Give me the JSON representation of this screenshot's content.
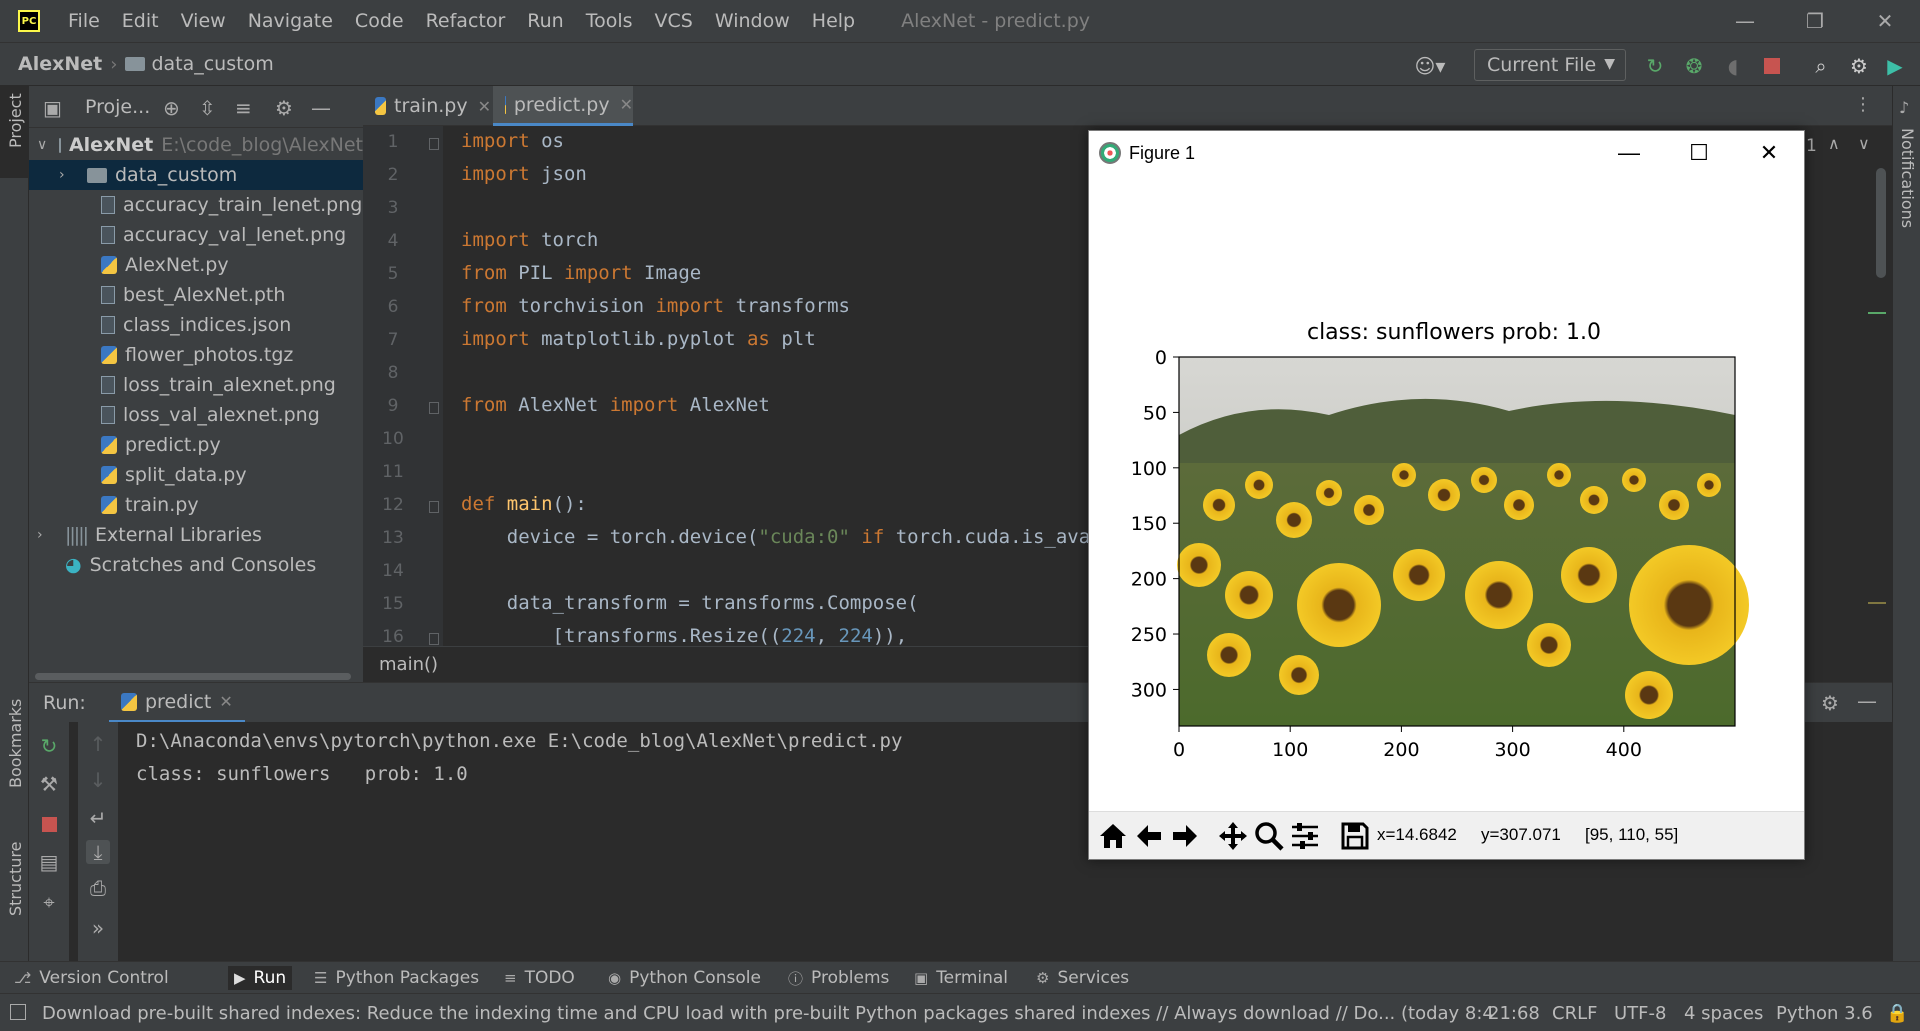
{
  "app": {
    "logo": "PC",
    "menu": [
      "File",
      "Edit",
      "View",
      "Navigate",
      "Code",
      "Refactor",
      "Run",
      "Tools",
      "VCS",
      "Window",
      "Help"
    ],
    "window_title": "AlexNet - predict.py"
  },
  "navbar": {
    "project": "AlexNet",
    "folder": "data_custom",
    "run_config": "Current File"
  },
  "left_stripe": {
    "project_label": "Project",
    "bookmarks_label": "Bookmarks",
    "structure_label": "Structure"
  },
  "right_stripe": {
    "notifications_label": "Notifications"
  },
  "project_panel": {
    "title": "Proje...",
    "root": {
      "name": "AlexNet",
      "path": "E:\\code_blog\\AlexNet"
    },
    "items": [
      {
        "name": "data_custom",
        "type": "folder"
      },
      {
        "name": "accuracy_train_lenet.png",
        "type": "image"
      },
      {
        "name": "accuracy_val_lenet.png",
        "type": "image"
      },
      {
        "name": "AlexNet.py",
        "type": "python"
      },
      {
        "name": "best_AlexNet.pth",
        "type": "file"
      },
      {
        "name": "class_indices.json",
        "type": "json"
      },
      {
        "name": "flower_photos.tgz",
        "type": "archive"
      },
      {
        "name": "loss_train_alexnet.png",
        "type": "image"
      },
      {
        "name": "loss_val_alexnet.png",
        "type": "image"
      },
      {
        "name": "predict.py",
        "type": "python"
      },
      {
        "name": "split_data.py",
        "type": "python"
      },
      {
        "name": "train.py",
        "type": "python"
      }
    ],
    "external_libraries": "External Libraries",
    "scratches": "Scratches and Consoles"
  },
  "editor": {
    "tabs": [
      {
        "label": "train.py",
        "active": false
      },
      {
        "label": "predict.py",
        "active": true
      }
    ],
    "line_numbers": [
      "1",
      "2",
      "3",
      "4",
      "5",
      "6",
      "7",
      "8",
      "9",
      "10",
      "11",
      "12",
      "13",
      "14",
      "15",
      "16"
    ],
    "breadcrumb": "main()",
    "right_counter": "1"
  },
  "run_panel": {
    "label": "Run:",
    "tab": "predict",
    "console": [
      "D:\\Anaconda\\envs\\pytorch\\python.exe E:\\code_blog\\AlexNet\\predict.py",
      "class: sunflowers   prob: 1.0"
    ]
  },
  "tool_buttons": [
    "Version Control",
    "Run",
    "Python Packages",
    "TODO",
    "Python Console",
    "Problems",
    "Terminal",
    "Services"
  ],
  "status_bar": {
    "message": "Download pre-built shared indexes: Reduce the indexing time and CPU load with pre-built Python packages shared indexes // Always download // Do... (today 8:4",
    "position": "21:68",
    "line_sep": "CRLF",
    "encoding": "UTF-8",
    "indent": "4 spaces",
    "interpreter": "Python 3.6"
  },
  "figure": {
    "window_title": "Figure 1",
    "plot_title": "class: sunflowers   prob: 1.0",
    "coord_x": "x=14.6842",
    "coord_y": "y=307.071",
    "pixel_value": "[95, 110, 55]"
  },
  "chart_data": {
    "type": "image",
    "title": "class: sunflowers   prob: 1.0",
    "xticks": [
      "0",
      "100",
      "200",
      "300",
      "400"
    ],
    "yticks": [
      "0",
      "50",
      "100",
      "150",
      "200",
      "250",
      "300"
    ],
    "xlim": [
      0,
      500
    ],
    "ylim": [
      333,
      0
    ]
  },
  "colors": {
    "keyword": "#cc7832",
    "function": "#ffc66d",
    "string": "#6a8759",
    "number": "#6897bb",
    "accent": "#4a88c7"
  }
}
